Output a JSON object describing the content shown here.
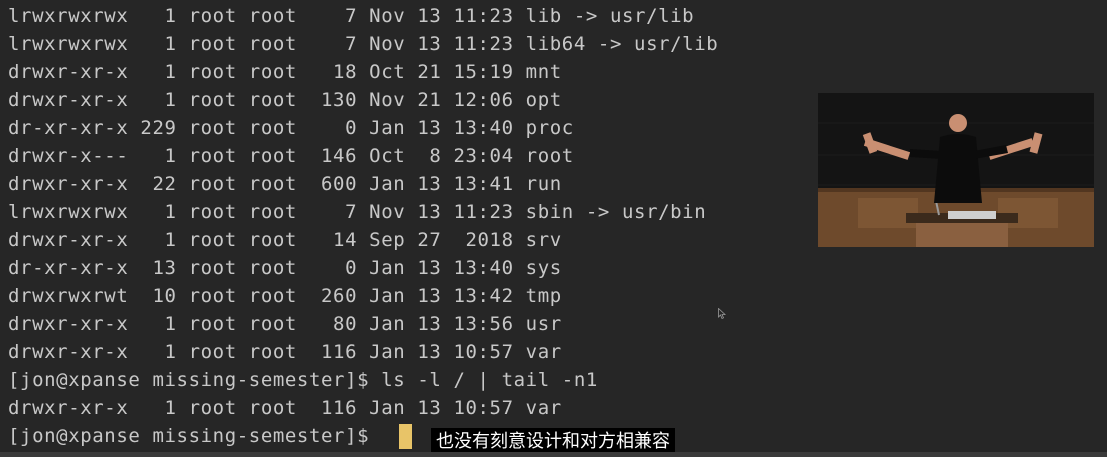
{
  "terminal": {
    "lines": [
      "lrwxrwxrwx   1 root root    7 Nov 13 11:23 lib -> usr/lib",
      "lrwxrwxrwx   1 root root    7 Nov 13 11:23 lib64 -> usr/lib",
      "drwxr-xr-x   1 root root   18 Oct 21 15:19 mnt",
      "drwxr-xr-x   1 root root  130 Nov 21 12:06 opt",
      "dr-xr-xr-x 229 root root    0 Jan 13 13:40 proc",
      "drwxr-x---   1 root root  146 Oct  8 23:04 root",
      "drwxr-xr-x  22 root root  600 Jan 13 13:41 run",
      "lrwxrwxrwx   1 root root    7 Nov 13 11:23 sbin -> usr/bin",
      "drwxr-xr-x   1 root root   14 Sep 27  2018 srv",
      "dr-xr-xr-x  13 root root    0 Jan 13 13:40 sys",
      "drwxrwxrwt  10 root root  260 Jan 13 13:42 tmp",
      "drwxr-xr-x   1 root root   80 Jan 13 13:56 usr",
      "drwxr-xr-x   1 root root  116 Jan 13 10:57 var",
      "[jon@xpanse missing-semester]$ ls -l / | tail -n1",
      "drwxr-xr-x   1 root root  116 Jan 13 10:57 var",
      "[jon@xpanse missing-semester]$ "
    ]
  },
  "subtitle": "也没有刻意设计和对方相兼容",
  "colors": {
    "background": "#262626",
    "text": "#c8c8c8",
    "cursor": "#e8c468"
  }
}
